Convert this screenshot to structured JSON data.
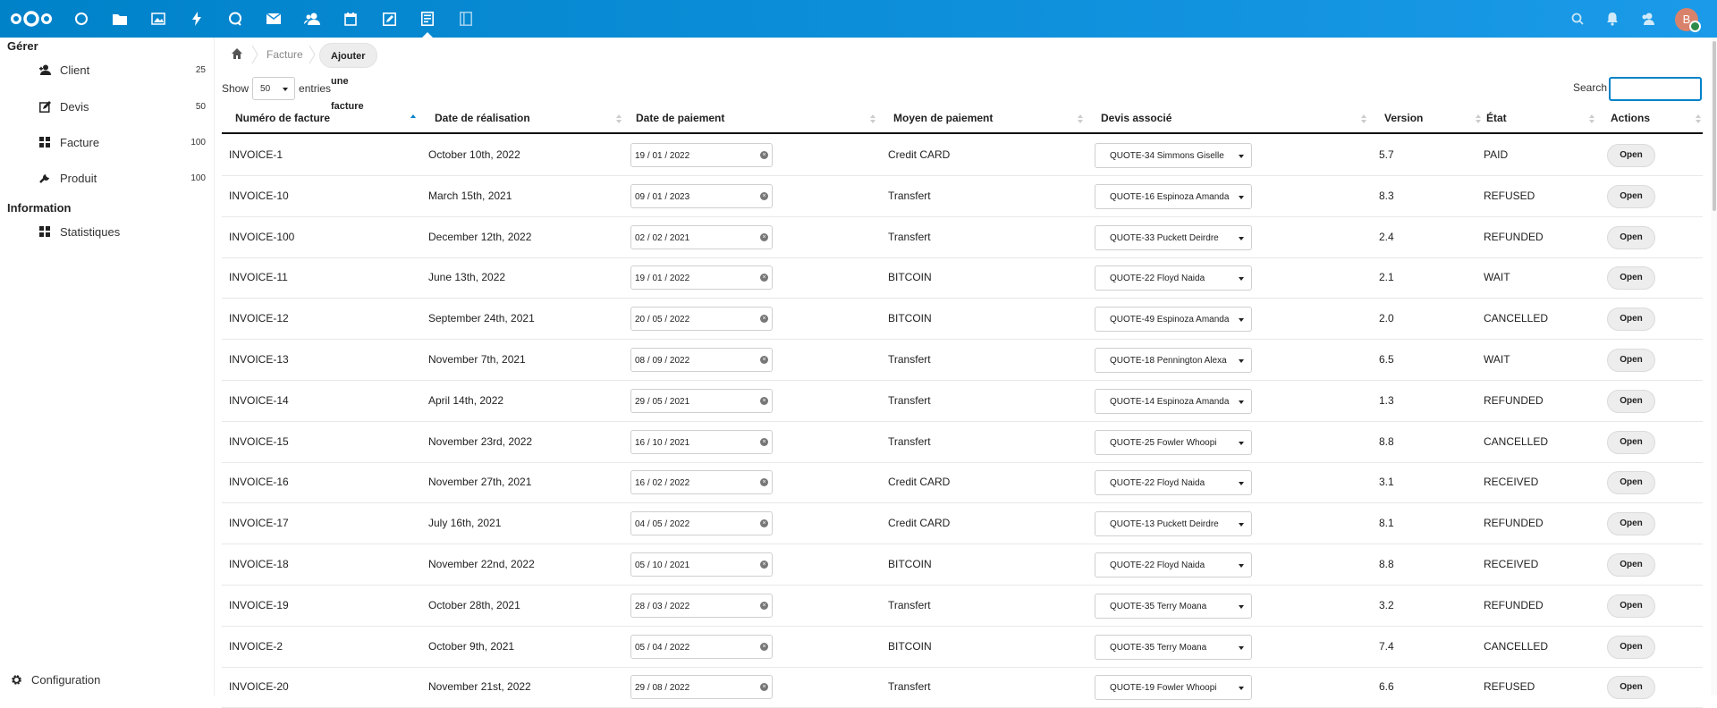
{
  "topbar": {
    "apps": [
      {
        "name": "dashboard",
        "icon": "circle-icon"
      },
      {
        "name": "files",
        "icon": "folder-icon"
      },
      {
        "name": "photos",
        "icon": "image-icon"
      },
      {
        "name": "activity",
        "icon": "lightning-icon"
      },
      {
        "name": "talk",
        "icon": "chat-icon"
      },
      {
        "name": "mail",
        "icon": "mail-icon"
      },
      {
        "name": "contacts",
        "icon": "contacts-icon"
      },
      {
        "name": "calendar",
        "icon": "calendar-icon"
      },
      {
        "name": "notes",
        "icon": "notes-icon"
      },
      {
        "name": "invoices",
        "icon": "invoice-app-icon",
        "active": true
      },
      {
        "name": "other",
        "icon": "document-app-icon"
      }
    ],
    "avatar_initial": "B",
    "accent": "#0082c9"
  },
  "sidebar": {
    "caption_manage": "Gérer",
    "items": [
      {
        "label": "Client",
        "count": "25",
        "icon": "user-icon"
      },
      {
        "label": "Devis",
        "count": "50",
        "icon": "edit-doc-icon"
      },
      {
        "label": "Facture",
        "count": "100",
        "icon": "grid-icon"
      },
      {
        "label": "Produit",
        "count": "100",
        "icon": "wrench-icon"
      }
    ],
    "caption_info": "Information",
    "info_items": [
      {
        "label": "Statistiques",
        "icon": "grid-icon"
      }
    ],
    "config_label": "Configuration"
  },
  "breadcrumb": {
    "section": "Facture",
    "action": "Ajouter une facture"
  },
  "table_controls": {
    "show_label": "Show",
    "entries_value": "50",
    "entries_label": "entries",
    "search_label": "Search",
    "search_value": ""
  },
  "table": {
    "headers": [
      "Numéro de facture",
      "Date de réalisation",
      "Date de paiement",
      "Moyen de paiement",
      "Devis associé",
      "Version",
      "État",
      "Actions"
    ],
    "open_label": "Open",
    "rows": [
      {
        "id": "INVOICE-1",
        "realisation": "October 10th, 2022",
        "paiement": "19 / 01 / 2022",
        "moyen": "Credit CARD",
        "devis": "QUOTE-34 Simmons Giselle",
        "version": "5.7",
        "etat": "PAID"
      },
      {
        "id": "INVOICE-10",
        "realisation": "March 15th, 2021",
        "paiement": "09 / 01 / 2023",
        "moyen": "Transfert",
        "devis": "QUOTE-16 Espinoza Amanda",
        "version": "8.3",
        "etat": "REFUSED"
      },
      {
        "id": "INVOICE-100",
        "realisation": "December 12th, 2022",
        "paiement": "02 / 02 / 2021",
        "moyen": "Transfert",
        "devis": "QUOTE-33 Puckett Deirdre",
        "version": "2.4",
        "etat": "REFUNDED"
      },
      {
        "id": "INVOICE-11",
        "realisation": "June 13th, 2022",
        "paiement": "19 / 01 / 2022",
        "moyen": "BITCOIN",
        "devis": "QUOTE-22 Floyd Naida",
        "version": "2.1",
        "etat": "WAIT"
      },
      {
        "id": "INVOICE-12",
        "realisation": "September 24th, 2021",
        "paiement": "20 / 05 / 2022",
        "moyen": "BITCOIN",
        "devis": "QUOTE-49 Espinoza Amanda",
        "version": "2.0",
        "etat": "CANCELLED"
      },
      {
        "id": "INVOICE-13",
        "realisation": "November 7th, 2021",
        "paiement": "08 / 09 / 2022",
        "moyen": "Transfert",
        "devis": "QUOTE-18 Pennington Alexa",
        "version": "6.5",
        "etat": "WAIT"
      },
      {
        "id": "INVOICE-14",
        "realisation": "April 14th, 2022",
        "paiement": "29 / 05 / 2021",
        "moyen": "Transfert",
        "devis": "QUOTE-14 Espinoza Amanda",
        "version": "1.3",
        "etat": "REFUNDED"
      },
      {
        "id": "INVOICE-15",
        "realisation": "November 23rd, 2022",
        "paiement": "16 / 10 / 2021",
        "moyen": "Transfert",
        "devis": "QUOTE-25 Fowler Whoopi",
        "version": "8.8",
        "etat": "CANCELLED"
      },
      {
        "id": "INVOICE-16",
        "realisation": "November 27th, 2021",
        "paiement": "16 / 02 / 2022",
        "moyen": "Credit CARD",
        "devis": "QUOTE-22 Floyd Naida",
        "version": "3.1",
        "etat": "RECEIVED"
      },
      {
        "id": "INVOICE-17",
        "realisation": "July 16th, 2021",
        "paiement": "04 / 05 / 2022",
        "moyen": "Credit CARD",
        "devis": "QUOTE-13 Puckett Deirdre",
        "version": "8.1",
        "etat": "REFUNDED"
      },
      {
        "id": "INVOICE-18",
        "realisation": "November 22nd, 2022",
        "paiement": "05 / 10 / 2021",
        "moyen": "BITCOIN",
        "devis": "QUOTE-22 Floyd Naida",
        "version": "8.8",
        "etat": "RECEIVED"
      },
      {
        "id": "INVOICE-19",
        "realisation": "October 28th, 2021",
        "paiement": "28 / 03 / 2022",
        "moyen": "Transfert",
        "devis": "QUOTE-35 Terry Moana",
        "version": "3.2",
        "etat": "REFUNDED"
      },
      {
        "id": "INVOICE-2",
        "realisation": "October 9th, 2021",
        "paiement": "05 / 04 / 2022",
        "moyen": "BITCOIN",
        "devis": "QUOTE-35 Terry Moana",
        "version": "7.4",
        "etat": "CANCELLED"
      },
      {
        "id": "INVOICE-20",
        "realisation": "November 21st, 2022",
        "paiement": "29 / 08 / 2022",
        "moyen": "Transfert",
        "devis": "QUOTE-19 Fowler Whoopi",
        "version": "6.6",
        "etat": "REFUSED"
      }
    ]
  }
}
